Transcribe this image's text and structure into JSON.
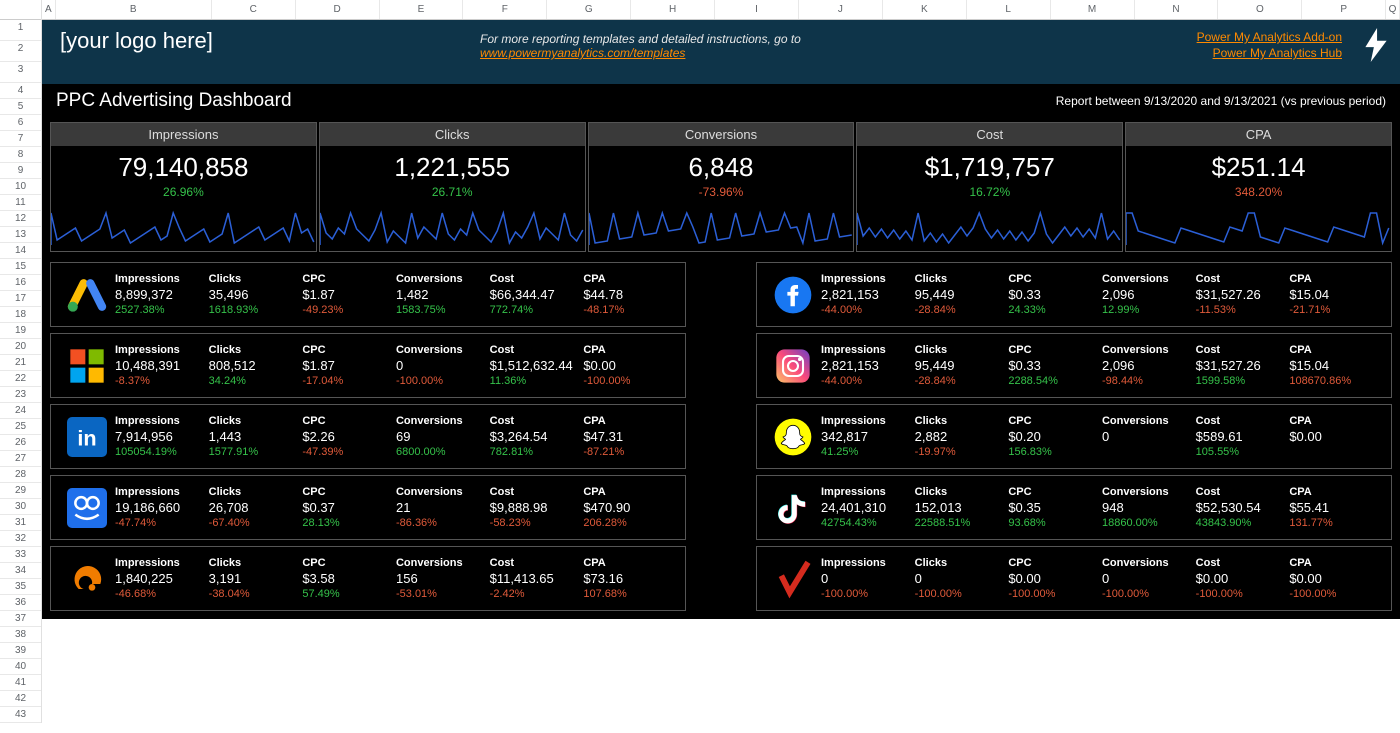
{
  "columns": [
    "A",
    "B",
    "C",
    "D",
    "E",
    "F",
    "G",
    "H",
    "I",
    "J",
    "K",
    "L",
    "M",
    "N",
    "O",
    "P",
    "Q"
  ],
  "rows": 43,
  "topbar": {
    "logo": "[your logo here]",
    "center_text": "For more reporting templates and detailed instructions, go to ",
    "center_link": "www.powermyanalytics.com/templates",
    "link1": "Power My Analytics Add-on",
    "link2": "Power My Analytics Hub"
  },
  "title": "PPC Advertising Dashboard",
  "report_range": "Report between 9/13/2020 and 9/13/2021 (vs previous period)",
  "hero": [
    {
      "label": "Impressions",
      "value": "79,140,858",
      "delta": "26.96%",
      "cls": "pos"
    },
    {
      "label": "Clicks",
      "value": "1,221,555",
      "delta": "26.71%",
      "cls": "pos"
    },
    {
      "label": "Conversions",
      "value": "6,848",
      "delta": "-73.96%",
      "cls": "neg"
    },
    {
      "label": "Cost",
      "value": "$1,719,757",
      "delta": "16.72%",
      "cls": "pos"
    },
    {
      "label": "CPA",
      "value": "$251.14",
      "delta": "348.20%",
      "cls": "neg"
    }
  ],
  "metric_labels": [
    "Impressions",
    "Clicks",
    "CPC",
    "Conversions",
    "Cost",
    "CPA"
  ],
  "platforms_left": [
    {
      "name": "google-ads",
      "values": [
        "8,899,372",
        "35,496",
        "$1.87",
        "1,482",
        "$66,344.47",
        "$44.78"
      ],
      "deltas": [
        "2527.38%",
        "1618.93%",
        "-49.23%",
        "1583.75%",
        "772.74%",
        "-48.17%"
      ],
      "delta_cls": [
        "pos",
        "pos",
        "neg",
        "pos",
        "pos",
        "neg"
      ]
    },
    {
      "name": "microsoft",
      "values": [
        "10,488,391",
        "808,512",
        "$1.87",
        "0",
        "$1,512,632.44",
        "$0.00"
      ],
      "deltas": [
        "-8.37%",
        "34.24%",
        "-17.04%",
        "-100.00%",
        "11.36%",
        "-100.00%"
      ],
      "delta_cls": [
        "neg",
        "pos",
        "neg",
        "neg",
        "pos",
        "neg"
      ]
    },
    {
      "name": "linkedin",
      "values": [
        "7,914,956",
        "1,443",
        "$2.26",
        "69",
        "$3,264.54",
        "$47.31"
      ],
      "deltas": [
        "105054.19%",
        "1577.91%",
        "-47.39%",
        "6800.00%",
        "782.81%",
        "-87.21%"
      ],
      "delta_cls": [
        "pos",
        "pos",
        "neg",
        "pos",
        "pos",
        "neg"
      ]
    },
    {
      "name": "taboola",
      "values": [
        "19,186,660",
        "26,708",
        "$0.37",
        "21",
        "$9,888.98",
        "$470.90"
      ],
      "deltas": [
        "-47.74%",
        "-67.40%",
        "28.13%",
        "-86.36%",
        "-58.23%",
        "206.28%"
      ],
      "delta_cls": [
        "neg",
        "neg",
        "pos",
        "neg",
        "neg",
        "neg"
      ]
    },
    {
      "name": "outbrain",
      "values": [
        "1,840,225",
        "3,191",
        "$3.58",
        "156",
        "$11,413.65",
        "$73.16"
      ],
      "deltas": [
        "-46.68%",
        "-38.04%",
        "57.49%",
        "-53.01%",
        "-2.42%",
        "107.68%"
      ],
      "delta_cls": [
        "neg",
        "neg",
        "pos",
        "neg",
        "neg",
        "neg"
      ]
    }
  ],
  "platforms_right": [
    {
      "name": "facebook",
      "values": [
        "2,821,153",
        "95,449",
        "$0.33",
        "2,096",
        "$31,527.26",
        "$15.04"
      ],
      "deltas": [
        "-44.00%",
        "-28.84%",
        "24.33%",
        "12.99%",
        "-11.53%",
        "-21.71%"
      ],
      "delta_cls": [
        "neg",
        "neg",
        "pos",
        "pos",
        "neg",
        "neg"
      ]
    },
    {
      "name": "instagram",
      "values": [
        "2,821,153",
        "95,449",
        "$0.33",
        "2,096",
        "$31,527.26",
        "$15.04"
      ],
      "deltas": [
        "-44.00%",
        "-28.84%",
        "2288.54%",
        "-98.44%",
        "1599.58%",
        "108670.86%"
      ],
      "delta_cls": [
        "neg",
        "neg",
        "pos",
        "neg",
        "pos",
        "neg"
      ]
    },
    {
      "name": "snapchat",
      "values": [
        "342,817",
        "2,882",
        "$0.20",
        "0",
        "$589.61",
        "$0.00"
      ],
      "deltas": [
        "41.25%",
        "-19.97%",
        "156.83%",
        "",
        "105.55%",
        ""
      ],
      "delta_cls": [
        "pos",
        "neg",
        "pos",
        "",
        "pos",
        ""
      ]
    },
    {
      "name": "tiktok",
      "values": [
        "24,401,310",
        "152,013",
        "$0.35",
        "948",
        "$52,530.54",
        "$55.41"
      ],
      "deltas": [
        "42754.43%",
        "22588.51%",
        "93.68%",
        "18860.00%",
        "43843.90%",
        "131.77%"
      ],
      "delta_cls": [
        "pos",
        "pos",
        "pos",
        "pos",
        "pos",
        "neg"
      ]
    },
    {
      "name": "verizon",
      "values": [
        "0",
        "0",
        "$0.00",
        "0",
        "$0.00",
        "$0.00"
      ],
      "deltas": [
        "-100.00%",
        "-100.00%",
        "-100.00%",
        "-100.00%",
        "-100.00%",
        "-100.00%"
      ],
      "delta_cls": [
        "neg",
        "neg",
        "neg",
        "neg",
        "neg",
        "neg"
      ]
    }
  ]
}
